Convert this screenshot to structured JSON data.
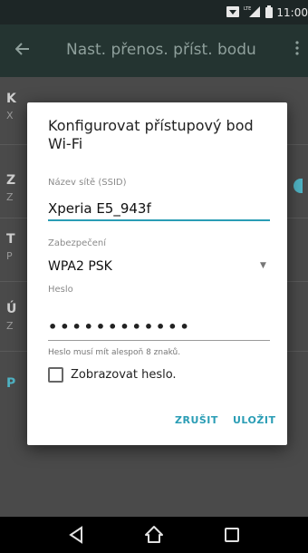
{
  "status_bar": {
    "time": "11:00",
    "network_label": "LTE",
    "icons": [
      "wifi-hotspot-icon",
      "signal-icon",
      "battery-icon"
    ]
  },
  "action_bar": {
    "title": "Nast. přenos. příst. bodu",
    "back_icon": "arrow-left-icon",
    "overflow_icon": "more-vert-icon"
  },
  "background": {
    "rows": [
      {
        "letter": "K",
        "sub": "X"
      },
      {
        "letter": "Z",
        "sub": "Z"
      },
      {
        "letter": "T",
        "sub": "P"
      },
      {
        "letter": "Ú",
        "sub": "Z"
      },
      {
        "letter": "P",
        "sub": ""
      }
    ]
  },
  "dialog": {
    "title": "Konfigurovat přístupový bod Wi-Fi",
    "ssid": {
      "label": "Název sítě (SSID)",
      "value": "Xperia E5_943f"
    },
    "security": {
      "label": "Zabezpečení",
      "value": "WPA2 PSK"
    },
    "password": {
      "label": "Heslo",
      "value": "••••••••••••",
      "hint": "Heslo musí mít alespoň 8 znaků."
    },
    "show_password": {
      "label": "Zobrazovat heslo.",
      "checked": false
    },
    "buttons": {
      "cancel": "ZRUŠIT",
      "save": "ULOŽIT"
    }
  },
  "nav_bar": {
    "icons": [
      "back-icon",
      "home-icon",
      "recents-icon"
    ]
  },
  "colors": {
    "accent": "#2a9db5",
    "action_bar": "#243431",
    "status_bar": "#1d2626"
  }
}
